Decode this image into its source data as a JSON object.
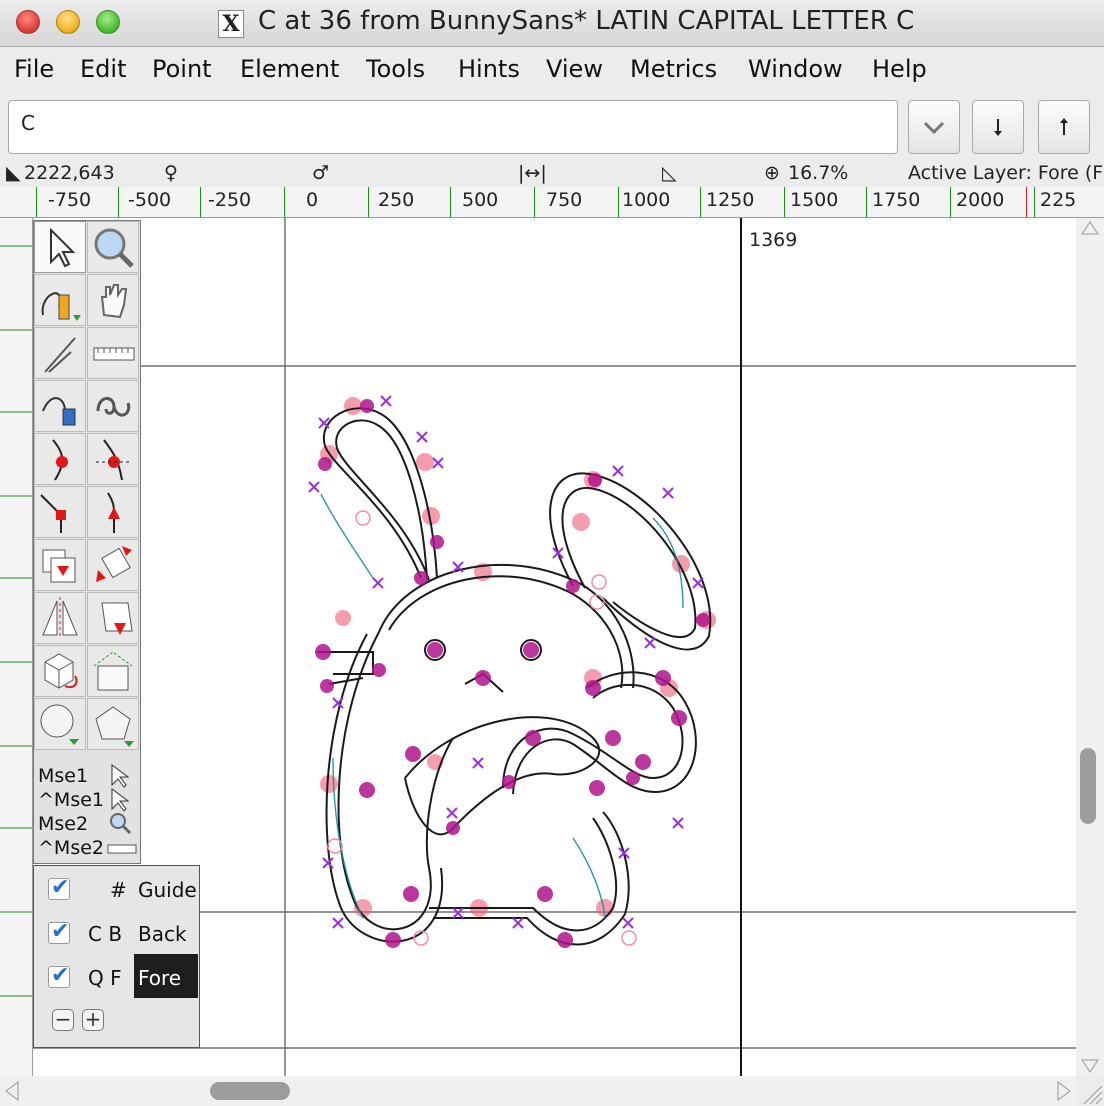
{
  "window": {
    "title": "C at 36 from BunnySans* LATIN CAPITAL LETTER C"
  },
  "menu": {
    "file": "File",
    "edit": "Edit",
    "point": "Point",
    "element": "Element",
    "tools": "Tools",
    "hints": "Hints",
    "view": "View",
    "metrics": "Metrics",
    "window": "Window",
    "help": "Help"
  },
  "search": {
    "value": "C"
  },
  "status": {
    "coords": "2222,643",
    "zoom": "16.7%",
    "active_layer": "Active Layer: Fore (F"
  },
  "ruler": {
    "labels": [
      "-750",
      "-500",
      "-250",
      "0",
      "250",
      "500",
      "750",
      "1000",
      "1250",
      "1500",
      "1750",
      "2000",
      "225"
    ]
  },
  "canvas": {
    "advance_width_label": "1369"
  },
  "tools": {
    "mouse_labels": [
      "Mse1",
      "^Mse1",
      "Mse2",
      "^Mse2"
    ]
  },
  "layers": {
    "guide": {
      "keys": "#",
      "name": "Guide"
    },
    "back": {
      "keys": "C B",
      "name": "Back"
    },
    "fore": {
      "keys": "Q F",
      "name": "Fore"
    },
    "remove": "−",
    "add": "+"
  },
  "colors": {
    "outline": "#1a1a1a",
    "points": "#b0148c",
    "control_points": "#f0607a",
    "guide_lines": "#555555",
    "ruler_ticks": "#1f8c1f",
    "active_layer_bg": "#1e1e1e"
  }
}
